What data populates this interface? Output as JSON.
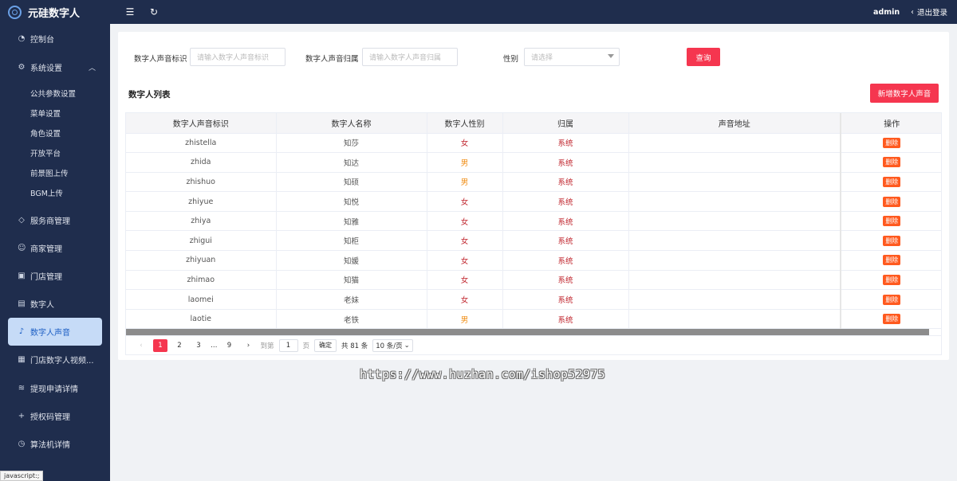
{
  "app": {
    "title": "元硅数字人"
  },
  "sidebar": {
    "items": [
      {
        "label": "控制台",
        "icon": "dashboard-icon"
      },
      {
        "label": "系统设置",
        "icon": "gear-icon",
        "expanded": true,
        "children": [
          "公共参数设置",
          "菜单设置",
          "角色设置",
          "开放平台",
          "前景图上传",
          "BGM上传"
        ]
      },
      {
        "label": "服务商管理",
        "icon": "diamond-icon"
      },
      {
        "label": "商家管理",
        "icon": "smile-icon"
      },
      {
        "label": "门店管理",
        "icon": "store-icon"
      },
      {
        "label": "数字人",
        "icon": "image-icon"
      },
      {
        "label": "数字人声音",
        "icon": "music-note-icon",
        "active": true
      },
      {
        "label": "门店数字人视频...",
        "icon": "video-icon"
      },
      {
        "label": "提现申请详情",
        "icon": "layers-icon"
      },
      {
        "label": "授权码管理",
        "icon": "plus-icon"
      },
      {
        "label": "算法机详情",
        "icon": "clock-icon"
      }
    ]
  },
  "header": {
    "user": "admin",
    "logout": "退出登录"
  },
  "filters": {
    "id_label": "数字人声音标识",
    "id_placeholder": "请输入数字人声音标识",
    "owner_label": "数字人声音归属",
    "owner_placeholder": "请输入数字人声音归属",
    "gender_label": "性别",
    "gender_placeholder": "请选择",
    "query_button": "查询"
  },
  "list": {
    "title": "数字人列表",
    "add_button": "新增数字人声音"
  },
  "table": {
    "columns": [
      "数字人声音标识",
      "数字人名称",
      "数字人性别",
      "归属",
      "声音地址",
      "操作"
    ],
    "delete_label": "删除",
    "rows": [
      {
        "id": "zhistella",
        "name": "知莎",
        "gender": "女",
        "owner": "系统",
        "url": ""
      },
      {
        "id": "zhida",
        "name": "知达",
        "gender": "男",
        "owner": "系统",
        "url": ""
      },
      {
        "id": "zhishuo",
        "name": "知硕",
        "gender": "男",
        "owner": "系统",
        "url": ""
      },
      {
        "id": "zhiyue",
        "name": "知悦",
        "gender": "女",
        "owner": "系统",
        "url": ""
      },
      {
        "id": "zhiya",
        "name": "知雅",
        "gender": "女",
        "owner": "系统",
        "url": ""
      },
      {
        "id": "zhigui",
        "name": "知柜",
        "gender": "女",
        "owner": "系统",
        "url": ""
      },
      {
        "id": "zhiyuan",
        "name": "知媛",
        "gender": "女",
        "owner": "系统",
        "url": ""
      },
      {
        "id": "zhimao",
        "name": "知猫",
        "gender": "女",
        "owner": "系统",
        "url": ""
      },
      {
        "id": "laomei",
        "name": "老妹",
        "gender": "女",
        "owner": "系统",
        "url": ""
      },
      {
        "id": "laotie",
        "name": "老铁",
        "gender": "男",
        "owner": "系统",
        "url": ""
      }
    ]
  },
  "pagination": {
    "pages": [
      "1",
      "2",
      "3",
      "…",
      "9"
    ],
    "current": "1",
    "goto_label": "到第",
    "goto_value": "1",
    "page_unit": "页",
    "confirm": "确定",
    "total": "共 81 条",
    "page_size": "10 条/页"
  },
  "status_bar": "javascript:;",
  "watermark": "https://www.huzhan.com/ishop52975",
  "colors": {
    "sidebar": "#1f2d4d",
    "accent": "#f5364f",
    "active_menu": "#c6dbf7",
    "female": "#c0262e",
    "male": "#f08c12",
    "delete": "#ff5a1f"
  }
}
